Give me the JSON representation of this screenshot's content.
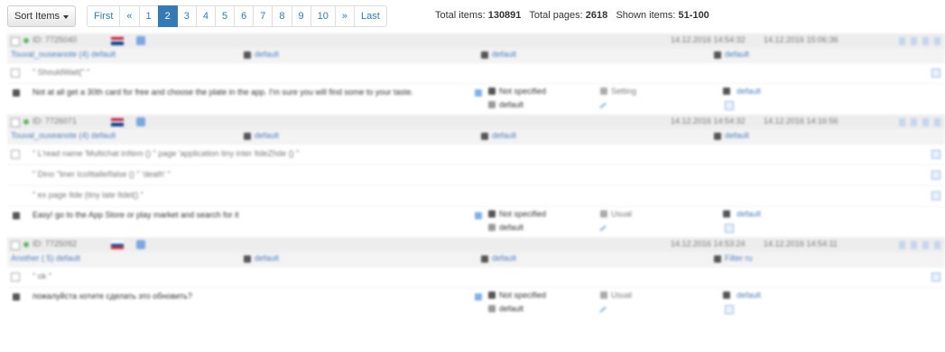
{
  "toolbar": {
    "sort_label": "Sort Items",
    "pagination": [
      "First",
      "«",
      "1",
      "2",
      "3",
      "4",
      "5",
      "6",
      "7",
      "8",
      "9",
      "10",
      "»",
      "Last"
    ],
    "active_page": "2",
    "total_items_label": "Total items:",
    "total_items": "130891",
    "total_pages_label": "Total pages:",
    "total_pages": "2618",
    "shown_items_label": "Shown items:",
    "shown_items": "51-100"
  },
  "items": [
    {
      "id": "ID: 7725040",
      "flag": "uk",
      "date1": "14.12.2016 14:54:32",
      "date2": "14.12.2016 15:06:36",
      "user": "Touval_ouseanote (4) default",
      "col2": "default",
      "col3": "default",
      "col4": "default",
      "lines": [
        "\" ShouldWait(\" \""
      ],
      "text": "Not at all get a 30th card for free and choose the plate in the app. I'm sure you will find some to your taste.",
      "status": "Not specified",
      "status2": "default",
      "category": "Setting",
      "right": "default"
    },
    {
      "id": "ID: 7726071",
      "flag": "uk",
      "date1": "14.12.2016 14:54:32",
      "date2": "14.12.2016 14:16:56",
      "user": "Touval_ouseanote (4) default",
      "col2": "default",
      "col3": "default",
      "col4": "default",
      "lines": [
        "\" L'read name 'Multichat inItem () \" page 'application tiny inter ItdeZhde () \"",
        "\" Dino \"liner IcoIttalleIfalse () \" 'death' \"",
        "\" ex page Itde (tiny late Itdel() \""
      ],
      "text": "Easy! go to the App Store or play market and search for it",
      "status": "Not specified",
      "status2": "default",
      "category": "Usual",
      "right": "default"
    },
    {
      "id": "ID: 7725092",
      "flag": "ru",
      "date1": "14.12.2016 14:53:24",
      "date2": "14.12.2016 14:54:11",
      "user": "Another ( 5) default",
      "col2": "default",
      "col3": "default",
      "col4": "Filter ru",
      "lines": [
        "\" ok \""
      ],
      "text": "пожалуйста хотите сделать это обновить?",
      "status": "Not specified",
      "status2": "default",
      "category": "Usual",
      "right": "default"
    }
  ]
}
